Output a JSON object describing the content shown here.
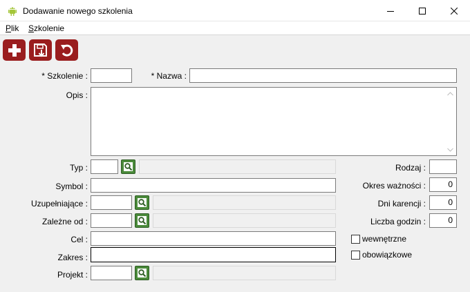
{
  "window": {
    "title": "Dodawanie nowego szkolenia",
    "app_icon": "android-icon",
    "controls": [
      "minimize-icon",
      "maximize-icon",
      "close-icon"
    ]
  },
  "menu": {
    "file": {
      "accel": "P",
      "rest": "lik"
    },
    "training": {
      "accel": "S",
      "rest": "zkolenie"
    }
  },
  "toolbar": {
    "color": "#9a1d1e",
    "buttons": [
      "add-icon",
      "save-icon",
      "undo-icon"
    ]
  },
  "form": {
    "szkolenie": {
      "label": "* Szkolenie :",
      "value": ""
    },
    "nazwa": {
      "label": "* Nazwa :",
      "value": ""
    },
    "opis": {
      "label": "Opis :",
      "value": ""
    },
    "typ": {
      "label": "Typ :",
      "code": "",
      "name": ""
    },
    "symbol": {
      "label": "Symbol :",
      "value": ""
    },
    "uzupelniajace": {
      "label": "Uzupełniające :",
      "code": "",
      "name": ""
    },
    "zalezne_od": {
      "label": "Zależne od :",
      "code": "",
      "name": ""
    },
    "cel": {
      "label": "Cel :",
      "value": ""
    },
    "zakres": {
      "label": "Zakres :",
      "value": ""
    },
    "projekt": {
      "label": "Projekt :",
      "code": "",
      "name": ""
    },
    "rodzaj": {
      "label": "Rodzaj :",
      "value": ""
    },
    "okres_waznosci": {
      "label": "Okres ważności :",
      "value": "0"
    },
    "dni_karencji": {
      "label": "Dni karencji :",
      "value": "0"
    },
    "liczba_godzin": {
      "label": "Liczba godzin :",
      "value": "0"
    },
    "wewnetrzne": {
      "label": "wewnętrzne",
      "checked": false
    },
    "obowiazkowe": {
      "label": "obowiązkowe",
      "checked": false
    }
  },
  "lookup_color": "#4a8a3a"
}
